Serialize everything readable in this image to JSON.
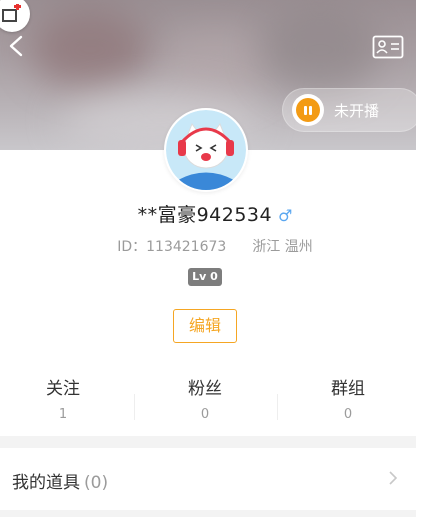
{
  "header": {
    "live_status": "未开播"
  },
  "profile": {
    "username": "**富豪942534",
    "gender_symbol": "♂",
    "id_label": "ID：113421673",
    "location": "浙江 温州",
    "level": "Lv 0",
    "edit_label": "编辑"
  },
  "stats": [
    {
      "label": "关注",
      "value": "1"
    },
    {
      "label": "粉丝",
      "value": "0"
    },
    {
      "label": "群组",
      "value": "0"
    }
  ],
  "menu": {
    "props_label": "我的道具",
    "props_count": "(0)"
  },
  "colors": {
    "accent": "#f5a623",
    "gender": "#5aa7f0",
    "level_badge": "#7d7d7d"
  }
}
